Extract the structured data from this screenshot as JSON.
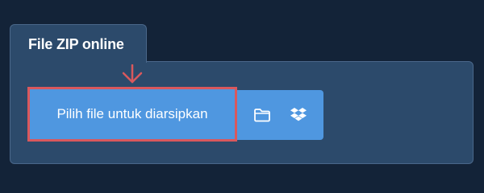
{
  "panel": {
    "title": "File ZIP online"
  },
  "upload": {
    "primary_label": "Pilih file untuk diarsipkan"
  },
  "icons": {
    "folder": "folder-icon",
    "dropbox": "dropbox-icon",
    "arrow": "arrow-down-icon"
  },
  "colors": {
    "page_background": "#132338",
    "panel_background": "#2c4a6b",
    "button_background": "#4f97e0",
    "highlight_border": "#d9585d",
    "text": "#ffffff"
  }
}
